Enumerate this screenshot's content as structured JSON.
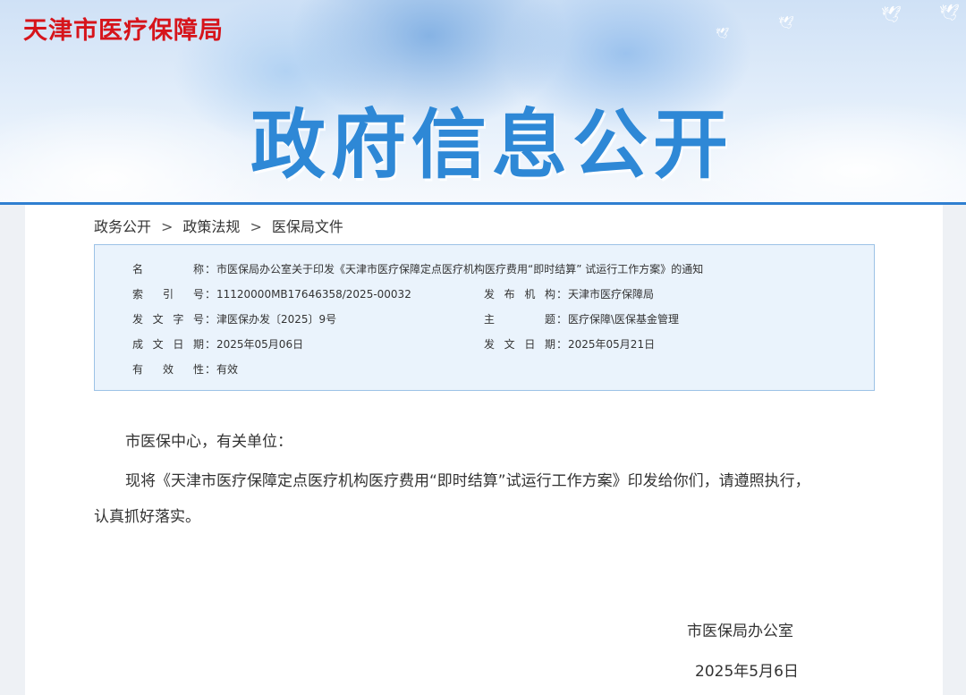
{
  "header": {
    "site_title": "天津市医疗保障局",
    "banner_title": "政府信息公开"
  },
  "breadcrumb": {
    "items": [
      "政务公开",
      "政策法规",
      "医保局文件"
    ],
    "separator": ">"
  },
  "meta": {
    "name_label": "名称",
    "name_value": "市医保局办公室关于印发《天津市医疗保障定点医疗机构医疗费用“即时结算” 试运行工作方案》的通知",
    "index_label": "索引号",
    "index_value": "11120000MB17646358/2025-00032",
    "publisher_label": "发布机构",
    "publisher_value": "天津市医疗保障局",
    "doc_no_label": "发文字号",
    "doc_no_value": "津医保办发〔2025〕9号",
    "topic_label": "主题",
    "topic_value": "医疗保障\\医保基金管理",
    "written_label": "成文日期",
    "written_value": "2025年05月06日",
    "issued_label": "发文日期",
    "issued_value": "2025年05月21日",
    "validity_label": "有效性",
    "validity_value": "有效",
    "colon": "："
  },
  "article": {
    "salutation": "市医保中心，有关单位：",
    "paragraph": "现将《天津市医疗保障定点医疗机构医疗费用“即时结算”试运行工作方案》印发给你们，请遵照执行，",
    "paragraph_cont": "认真抓好落实。",
    "signature_org": "市医保局办公室",
    "signature_date": "2025年5月6日"
  },
  "colors": {
    "site_title": "#d6141b",
    "banner_title": "#2e88d6",
    "meta_border": "#9cc2e6",
    "meta_bg": "#eaf3fc"
  }
}
